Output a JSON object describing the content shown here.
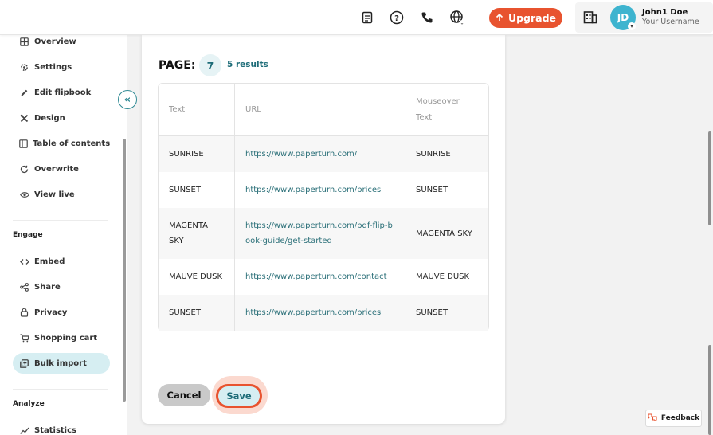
{
  "topbar": {
    "icons": [
      "document-icon",
      "help-icon",
      "phone-icon",
      "globe-icon"
    ],
    "upgrade_label": "Upgrade",
    "accent": "#e8532f",
    "user": {
      "initials": "JD",
      "name": "John1 Doe",
      "username": "Your Username"
    }
  },
  "sidebar": {
    "items": [
      {
        "label": "Overview",
        "icon": "overview-icon"
      },
      {
        "label": "Settings",
        "icon": "gear-icon"
      },
      {
        "label": "Edit flipbook",
        "icon": "pencil-icon"
      },
      {
        "label": "Design",
        "icon": "design-icon"
      },
      {
        "label": "Table of contents",
        "icon": "toc-icon"
      },
      {
        "label": "Overwrite",
        "icon": "refresh-icon"
      },
      {
        "label": "View live",
        "icon": "eye-icon"
      }
    ],
    "engage": {
      "title": "Engage",
      "items": [
        {
          "label": "Embed",
          "icon": "code-icon"
        },
        {
          "label": "Share",
          "icon": "share-icon"
        },
        {
          "label": "Privacy",
          "icon": "lock-icon"
        },
        {
          "label": "Shopping cart",
          "icon": "cart-icon"
        },
        {
          "label": "Bulk import",
          "icon": "import-icon",
          "active": true
        }
      ]
    },
    "analyze": {
      "title": "Analyze",
      "items": [
        {
          "label": "Statistics",
          "icon": "chart-icon"
        }
      ]
    },
    "collapse_glyph": "«"
  },
  "main": {
    "page_label": "PAGE:",
    "page_number": "7",
    "results": "5 results",
    "table": {
      "headers": [
        "Text",
        "URL",
        "Mouseover Text"
      ],
      "rows": [
        {
          "text": "SUNRISE",
          "url": "https://www.paperturn.com/",
          "mouseover": "SUNRISE"
        },
        {
          "text": "SUNSET",
          "url": "https://www.paperturn.com/prices",
          "mouseover": "SUNSET"
        },
        {
          "text": "MAGENTA SKY",
          "url": "https://www.paperturn.com/pdf-flip-book-guide/get-started",
          "mouseover": "MAGENTA SKY"
        },
        {
          "text": "MAUVE DUSK",
          "url": "https://www.paperturn.com/contact",
          "mouseover": "MAUVE DUSK"
        },
        {
          "text": "SUNSET",
          "url": "https://www.paperturn.com/prices",
          "mouseover": "SUNSET"
        }
      ]
    },
    "cancel_label": "Cancel",
    "save_label": "Save"
  },
  "feedback_label": "Feedback"
}
